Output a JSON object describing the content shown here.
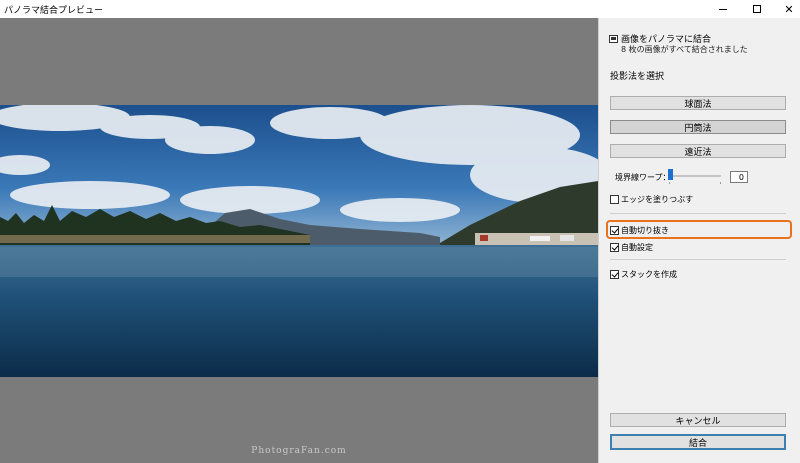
{
  "window": {
    "title": "パノラマ結合プレビュー"
  },
  "panel": {
    "header_title": "画像をパノラマに結合",
    "header_subtitle": "8 枚の画像がすべて結合されました",
    "projection_label": "投影法を選択",
    "projection_buttons": [
      "球面法",
      "円筒法",
      "遠近法"
    ],
    "selected_projection": "円筒法",
    "boundary_warp_label": "境界線ワープ：",
    "boundary_warp_value": "0",
    "fill_edges_label": "エッジを塗りつぶす",
    "fill_edges_checked": false,
    "auto_crop_label": "自動切り抜き",
    "auto_crop_checked": true,
    "auto_settings_label": "自動設定",
    "auto_settings_checked": true,
    "create_stack_label": "スタックを作成",
    "create_stack_checked": true,
    "cancel_label": "キャンセル",
    "merge_label": "結合"
  },
  "preview": {
    "watermark": "PhotograFan.com"
  },
  "colors": {
    "highlight": "#e9731d",
    "primary_border": "#3c7fb1",
    "slider_thumb": "#1e6fd0",
    "preview_bg": "#7b7b7b"
  }
}
